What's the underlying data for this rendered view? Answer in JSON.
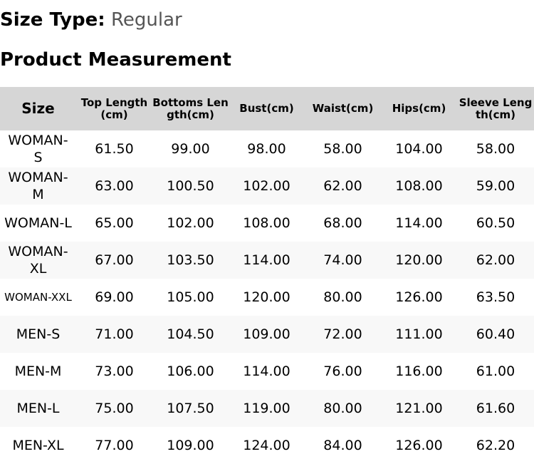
{
  "size_type": {
    "label": "Size Type:",
    "value": "Regular"
  },
  "section_title": "Product Measurement",
  "table": {
    "headers": [
      "Size",
      "Top Length(cm)",
      "Bottoms Length(cm)",
      "Bust(cm)",
      "Waist(cm)",
      "Hips(cm)",
      "Sleeve Length(cm)"
    ],
    "rows": [
      [
        "WOMAN-S",
        "61.50",
        "99.00",
        "98.00",
        "58.00",
        "104.00",
        "58.00"
      ],
      [
        "WOMAN-M",
        "63.00",
        "100.50",
        "102.00",
        "62.00",
        "108.00",
        "59.00"
      ],
      [
        "WOMAN-L",
        "65.00",
        "102.00",
        "108.00",
        "68.00",
        "114.00",
        "60.50"
      ],
      [
        "WOMAN-XL",
        "67.00",
        "103.50",
        "114.00",
        "74.00",
        "120.00",
        "62.00"
      ],
      [
        "WOMAN-XXL",
        "69.00",
        "105.00",
        "120.00",
        "80.00",
        "126.00",
        "63.50"
      ],
      [
        "MEN-S",
        "71.00",
        "104.50",
        "109.00",
        "72.00",
        "111.00",
        "60.40"
      ],
      [
        "MEN-M",
        "73.00",
        "106.00",
        "114.00",
        "76.00",
        "116.00",
        "61.00"
      ],
      [
        "MEN-L",
        "75.00",
        "107.50",
        "119.00",
        "80.00",
        "121.00",
        "61.60"
      ],
      [
        "MEN-XL",
        "77.00",
        "109.00",
        "124.00",
        "84.00",
        "126.00",
        "62.20"
      ]
    ]
  }
}
